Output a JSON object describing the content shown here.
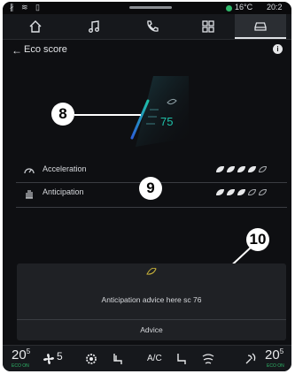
{
  "status_bar": {
    "left_icons": "∦ ≋ ▯",
    "temperature": "16°C",
    "time": "20:2"
  },
  "nav": {
    "items": [
      {
        "name": "home",
        "icon": "home-icon"
      },
      {
        "name": "music",
        "icon": "music-icon"
      },
      {
        "name": "phone",
        "icon": "phone-icon"
      },
      {
        "name": "apps",
        "icon": "apps-grid-icon"
      },
      {
        "name": "vehicle",
        "icon": "car-icon",
        "active": true
      }
    ]
  },
  "header": {
    "back": "←",
    "title": "Eco score",
    "info": "i"
  },
  "gauge": {
    "value": "75",
    "level": 0.75,
    "color": "#1ec0a8"
  },
  "callouts": {
    "gauge": "8",
    "rows": "9",
    "advice": "10"
  },
  "rows": [
    {
      "label": "Acceleration",
      "icon": "gauge-icon",
      "filled": 4,
      "total": 5
    },
    {
      "label": "Anticipation",
      "icon": "hand-icon",
      "filled": 3,
      "total": 5
    }
  ],
  "advice": {
    "text": "Anticipation advice here sc 76",
    "button": "Advice",
    "leaf_color": "#c9b33a"
  },
  "bottom_bar": {
    "left_temp": "20",
    "left_temp_suffix": "5",
    "left_eco": "ECO ON",
    "fan_speed": "5",
    "ac_label": "A/C",
    "right_temp": "20",
    "right_temp_suffix": "5",
    "right_eco": "ECO ON"
  },
  "colors": {
    "background": "#0e0f12",
    "accent": "#1ec0a8",
    "eco_green": "#2fb86a"
  }
}
